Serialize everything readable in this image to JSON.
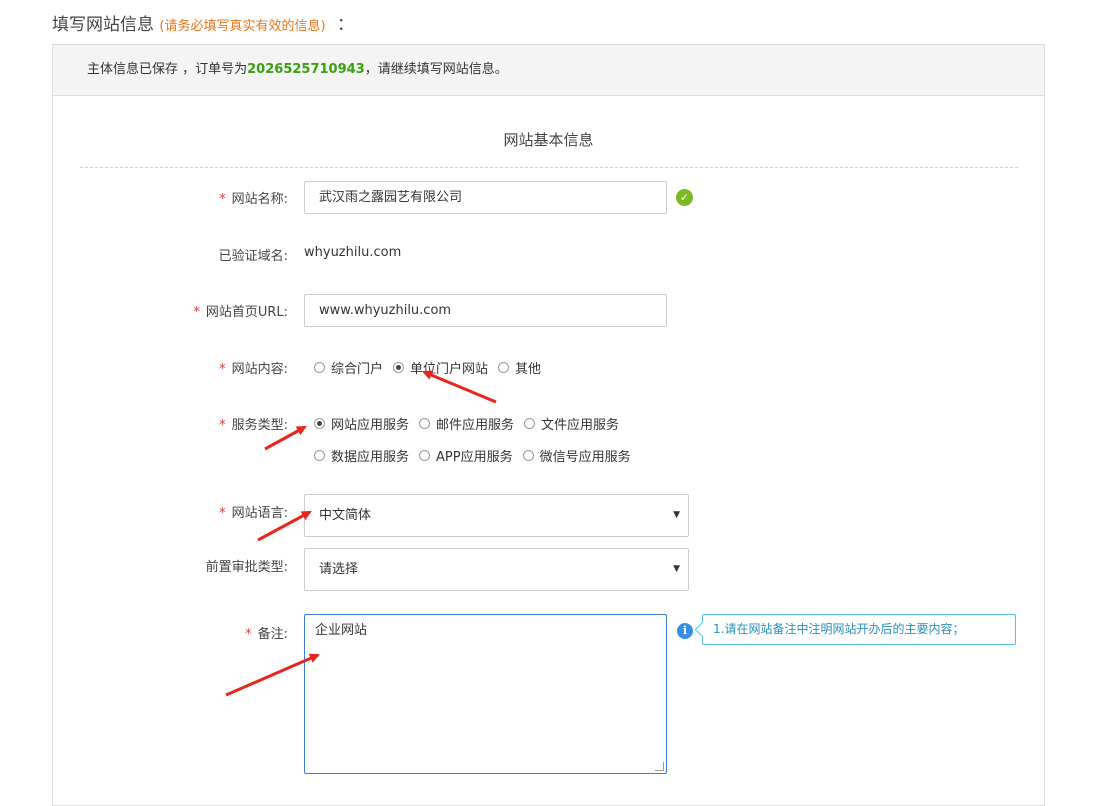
{
  "header": {
    "title": "填写网站信息",
    "hint": "(请务必填写真实有效的信息)",
    "colon": "："
  },
  "notice": {
    "prefix": "主体信息已保存 ，订单号为",
    "order_number": "2026525710943",
    "suffix": "，请继续填写网站信息。"
  },
  "section": {
    "title": "网站基本信息"
  },
  "form": {
    "required_mark": "*",
    "site_name": {
      "label": "网站名称:",
      "value": "武汉雨之露园艺有限公司"
    },
    "verified_domain": {
      "label": "已验证域名:",
      "value": "whyuzhilu.com"
    },
    "home_url": {
      "label": "网站首页URL:",
      "value": "www.whyuzhilu.com"
    },
    "content": {
      "label": "网站内容:",
      "options": [
        "综合门户",
        "单位门户网站",
        "其他"
      ],
      "selected": "单位门户网站"
    },
    "service_type": {
      "label": "服务类型:",
      "options": [
        "网站应用服务",
        "邮件应用服务",
        "文件应用服务",
        "数据应用服务",
        "APP应用服务",
        "微信号应用服务"
      ],
      "selected": "网站应用服务"
    },
    "language": {
      "label": "网站语言:",
      "value": "中文简体"
    },
    "pre_approval": {
      "label": "前置审批类型:",
      "value": "请选择"
    },
    "remark": {
      "label": "备注:",
      "value": "企业网站",
      "tip": "1.请在网站备注中注明网站开办后的主要内容；"
    }
  },
  "icons": {
    "valid": "check-circle-icon",
    "info": "info-circle-icon",
    "caret": "caret-down-icon",
    "annotation": "red-arrow"
  },
  "colors": {
    "accent_green": "#3aa00e",
    "check_green": "#7cba23",
    "hint_orange": "#e8761c",
    "required_red": "#e23a3a",
    "info_blue": "#3a8ee6",
    "tip_text": "#2a8fbd",
    "arrow_red": "#e8261c"
  }
}
